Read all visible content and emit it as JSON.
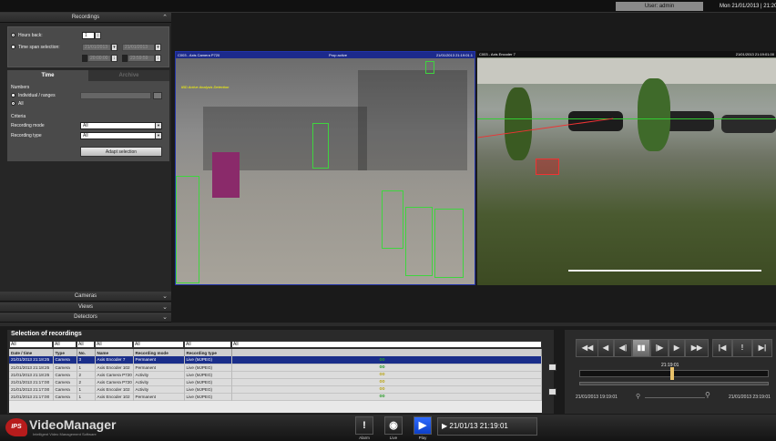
{
  "topbar": {
    "user": "User: admin",
    "datetime": "Mon 21/01/2013 | 21:20:2"
  },
  "recordings": {
    "header": "Recordings",
    "hours_back_label": "Hours back:",
    "hours_back_value": "1",
    "time_span_label": "Time span selection:",
    "date_from": "21/01/2013",
    "date_to": "21/01/2013",
    "time_from": "20:00:00",
    "time_to": "23:59:59"
  },
  "tabs": {
    "time": "Time",
    "archive": "Archive"
  },
  "time_panel": {
    "numbers_label": "Numbers",
    "individual_label": "Individual / ranges",
    "all_label": "All",
    "criteria_label": "Criteria",
    "recording_mode_label": "Recording mode",
    "recording_mode_value": "All",
    "recording_type_label": "Recording type",
    "recording_type_value": "All",
    "adapt_button": "Adapt selection"
  },
  "sections": {
    "cameras": "Cameras",
    "views": "Views",
    "detectors": "Detectors"
  },
  "cameras": {
    "cam1_title": "C003 - Axis Camera P720",
    "cam1_status": "Prop active",
    "cam1_time": "21/01/2013 21:19:01.1",
    "cam1_overlay": "IBD Active Analysis Detection",
    "cam2_title": "C003 - Axis Encoder 7",
    "cam2_time": "21/01/2013 21:19:01.00"
  },
  "selection": {
    "title": "Selection of recordings",
    "filters": [
      "All",
      "All",
      "All",
      "All",
      "All",
      "All",
      "All"
    ],
    "columns": [
      "Date / time",
      "Type",
      "No.",
      "Name",
      "Recording mode",
      "Recording type"
    ],
    "rows": [
      {
        "dt": "21/01/2013 21:18:25",
        "type": "Camera",
        "no": "3",
        "name": "Axis Encoder 7",
        "mode": "Permanent",
        "rtype": "Live (MJPEG)",
        "icon": "permanent"
      },
      {
        "dt": "21/01/2013 21:18:25",
        "type": "Camera",
        "no": "1",
        "name": "Axis Encoder 102",
        "mode": "Permanent",
        "rtype": "Live (MJPEG)",
        "icon": "permanent"
      },
      {
        "dt": "21/01/2013 21:18:25",
        "type": "Camera",
        "no": "2",
        "name": "Axis Camera P720",
        "mode": "Activity",
        "rtype": "Live (MJPEG)",
        "icon": "activity"
      },
      {
        "dt": "21/01/2013 21:17:00",
        "type": "Camera",
        "no": "2",
        "name": "Axis Camera P720",
        "mode": "Activity",
        "rtype": "Live (MJPEG)",
        "icon": "activity"
      },
      {
        "dt": "21/01/2013 21:17:00",
        "type": "Camera",
        "no": "1",
        "name": "Axis Encoder 102",
        "mode": "Activity",
        "rtype": "Live (MJPEG)",
        "icon": "activity"
      },
      {
        "dt": "21/01/2013 21:17:00",
        "type": "Camera",
        "no": "1",
        "name": "Axis Encoder 102",
        "mode": "Permanent",
        "rtype": "Live (MJPEG)",
        "icon": "permanent"
      }
    ]
  },
  "playback": {
    "buttons": [
      "◀◀",
      "◀",
      "◀|",
      "▮▮",
      "|▶",
      "▶",
      "▶▶",
      "|◀",
      "!",
      "▶|"
    ],
    "current_time": "21:19:01",
    "start": "21/01/2013 19:19:01",
    "end": "21/01/2013 23:19:01"
  },
  "bottombar": {
    "logo_badge": "IPS",
    "logo_text": "VideoManager",
    "logo_sub": "Intelligent Video Management Software",
    "alarm_label": "Alarm",
    "live_label": "Live",
    "play_label": "Play",
    "live_time": "▶ 21/01/13  21:19:01"
  }
}
